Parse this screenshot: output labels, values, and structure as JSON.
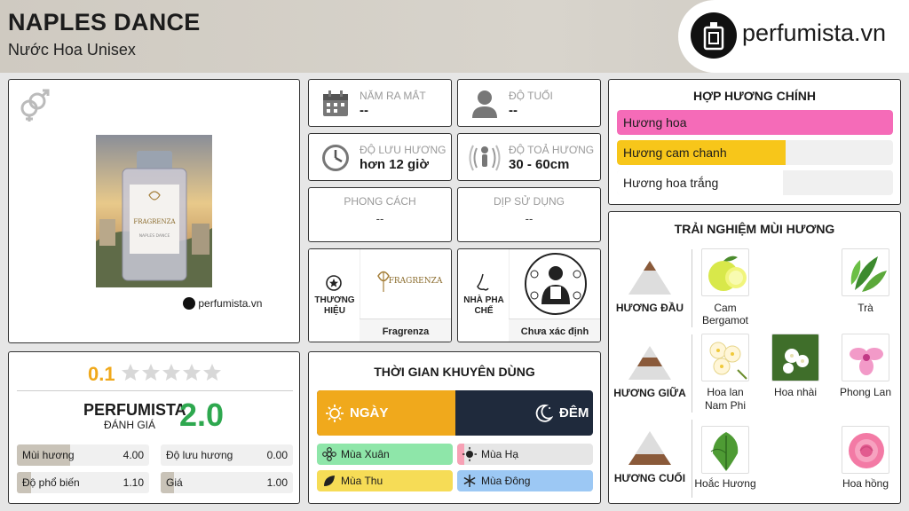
{
  "header": {
    "title": "NAPLES DANCE",
    "subtitle": "Nước Hoa Unisex",
    "logo_text": "perfumista.vn"
  },
  "product": {
    "gender_icon": "unisex-gender-icon",
    "bottle_brand_text": "FRAGRENZA",
    "bottle_name_text": "NAPLES DANCE",
    "watermark": "perfumista.vn"
  },
  "info": {
    "release": {
      "label": "NĂM RA MẮT",
      "value": "--",
      "icon": "calendar-icon"
    },
    "age": {
      "label": "ĐỘ TUỔI",
      "value": "--",
      "icon": "person-icon"
    },
    "longevity": {
      "label": "ĐỘ LƯU HƯƠNG",
      "value": "hơn 12 giờ",
      "icon": "clock-icon"
    },
    "sillage": {
      "label": "ĐỘ TOẢ HƯƠNG",
      "value": "30 - 60cm",
      "icon": "sillage-icon"
    },
    "style": {
      "label": "PHONG CÁCH",
      "value": "--"
    },
    "occasion": {
      "label": "DỊP SỬ DỤNG",
      "value": "--"
    }
  },
  "brand": {
    "label": "THƯƠNG HIỆU",
    "logo_text": "FRAGRENZA",
    "name": "Fragrenza",
    "icon": "star-badge-icon"
  },
  "perfumer": {
    "label": "NHÀ PHA CHẾ",
    "name": "Chưa xác định",
    "icon": "nose-icon"
  },
  "accords": {
    "title": "HỢP HƯƠNG CHÍNH",
    "items": [
      {
        "name": "Hương hoa",
        "level": 1.0,
        "color": "#f56bb8"
      },
      {
        "name": "Hương cam chanh",
        "level": 0.61,
        "color": "#f7c61a"
      },
      {
        "name": "Hương hoa trắng",
        "level": 0.6,
        "color": "#ffffff"
      }
    ]
  },
  "rating": {
    "user_score": "0.1",
    "stars_filled": 0,
    "stars_total": 5,
    "brand_label": "PERFUMISTA",
    "brand_sub": "ĐÁNH GIÁ",
    "brand_score": "2.0",
    "stats": [
      {
        "label": "Mùi hương",
        "value": "4.00",
        "level": 0.4
      },
      {
        "label": "Độ lưu hương",
        "value": "0.00",
        "level": 0.0
      },
      {
        "label": "Độ phổ biến",
        "value": "1.10",
        "level": 0.11
      },
      {
        "label": "Giá",
        "value": "1.00",
        "level": 0.1
      }
    ]
  },
  "timing": {
    "title": "THỜI GIAN KHUYÊN DÙNG",
    "day_label": "NGÀY",
    "night_label": "ĐÊM",
    "day_level": 0.5,
    "seasons": [
      {
        "name": "Mùa Xuân",
        "color": "#8ee6a9",
        "level": 1.0,
        "icon": "flower-icon"
      },
      {
        "name": "Mùa Hạ",
        "color": "#f7a1b5",
        "level": 0.05,
        "icon": "sun-icon"
      },
      {
        "name": "Mùa Thu",
        "color": "#f6dc56",
        "level": 1.0,
        "icon": "leaf-icon"
      },
      {
        "name": "Mùa Đông",
        "color": "#9cc8f4",
        "level": 1.0,
        "icon": "snowflake-icon"
      }
    ]
  },
  "notes": {
    "title": "TRẢI NGHIỆM MÙI HƯƠNG",
    "top_label": "HƯƠNG ĐẦU",
    "middle_label": "HƯƠNG GIỮA",
    "base_label": "HƯƠNG CUỐI",
    "top": [
      {
        "name": "Cam Bergamot"
      },
      {
        "name": "Trà"
      }
    ],
    "middle": [
      {
        "name": "Hoa lan Nam Phi"
      },
      {
        "name": "Hoa nhài"
      },
      {
        "name": "Phong Lan"
      }
    ],
    "base": [
      {
        "name": "Hoắc Hương"
      },
      {
        "name": "Hoa hồng"
      }
    ]
  },
  "colors": {
    "accent_gold": "#f0a91c",
    "score_green": "#2ea84f",
    "night_navy": "#1f2a3c"
  }
}
